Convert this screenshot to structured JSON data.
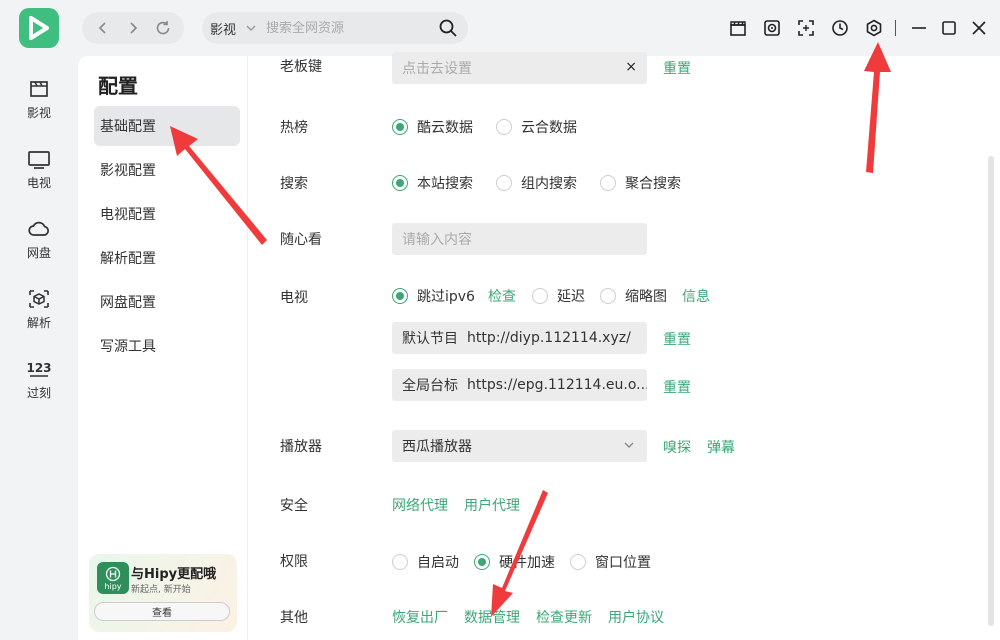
{
  "colors": {
    "brand": "#3fbf7f",
    "accent": "#3ba776",
    "arrow": "#ef3b3b"
  },
  "search": {
    "category": "影视",
    "placeholder": "搜索全网资源"
  },
  "rail": [
    {
      "label": "影视",
      "icon": "film-icon"
    },
    {
      "label": "电视",
      "icon": "tv-icon"
    },
    {
      "label": "网盘",
      "icon": "cloud-icon"
    },
    {
      "label": "解析",
      "icon": "cube-icon"
    },
    {
      "label": "过刻",
      "icon": "counter-icon"
    }
  ],
  "subnav": {
    "title": "配置",
    "items": [
      "基础配置",
      "影视配置",
      "电视配置",
      "解析配置",
      "网盘配置",
      "写源工具"
    ],
    "active_index": 0
  },
  "promo": {
    "logo_text": "hipy",
    "title": "与Hipy更配哦",
    "subtitle": "新起点, 新开始",
    "button": "查看"
  },
  "settings": {
    "boss_key": {
      "label": "老板键",
      "placeholder": "点击去设置",
      "clear": "×",
      "reset": "重置"
    },
    "hot": {
      "label": "热榜",
      "options": [
        "酷云数据",
        "云合数据"
      ]
    },
    "search": {
      "label": "搜索",
      "options": [
        "本站搜索",
        "组内搜索",
        "聚合搜索"
      ]
    },
    "random": {
      "label": "随心看",
      "placeholder": "请输入内容"
    },
    "tv": {
      "label": "电视",
      "skip_ipv6": "跳过ipv6",
      "check": "检查",
      "delay": "延迟",
      "thumbnail": "缩略图",
      "info": "信息",
      "default_program": "默认节目",
      "default_program_url": "http://diyp.112114.xyz/",
      "global_logo": "全局台标",
      "global_logo_url": "https://epg.112114.eu.o...",
      "reset": "重置"
    },
    "player": {
      "label": "播放器",
      "value": "西瓜播放器",
      "sniff": "嗅探",
      "danmaku": "弹幕"
    },
    "security": {
      "label": "安全",
      "proxy": "网络代理",
      "ua": "用户代理"
    },
    "permission": {
      "label": "权限",
      "options": [
        "自启动",
        "硬件加速",
        "窗口位置"
      ]
    },
    "other": {
      "label": "其他",
      "links": [
        "恢复出厂",
        "数据管理",
        "检查更新",
        "用户协议"
      ]
    }
  }
}
